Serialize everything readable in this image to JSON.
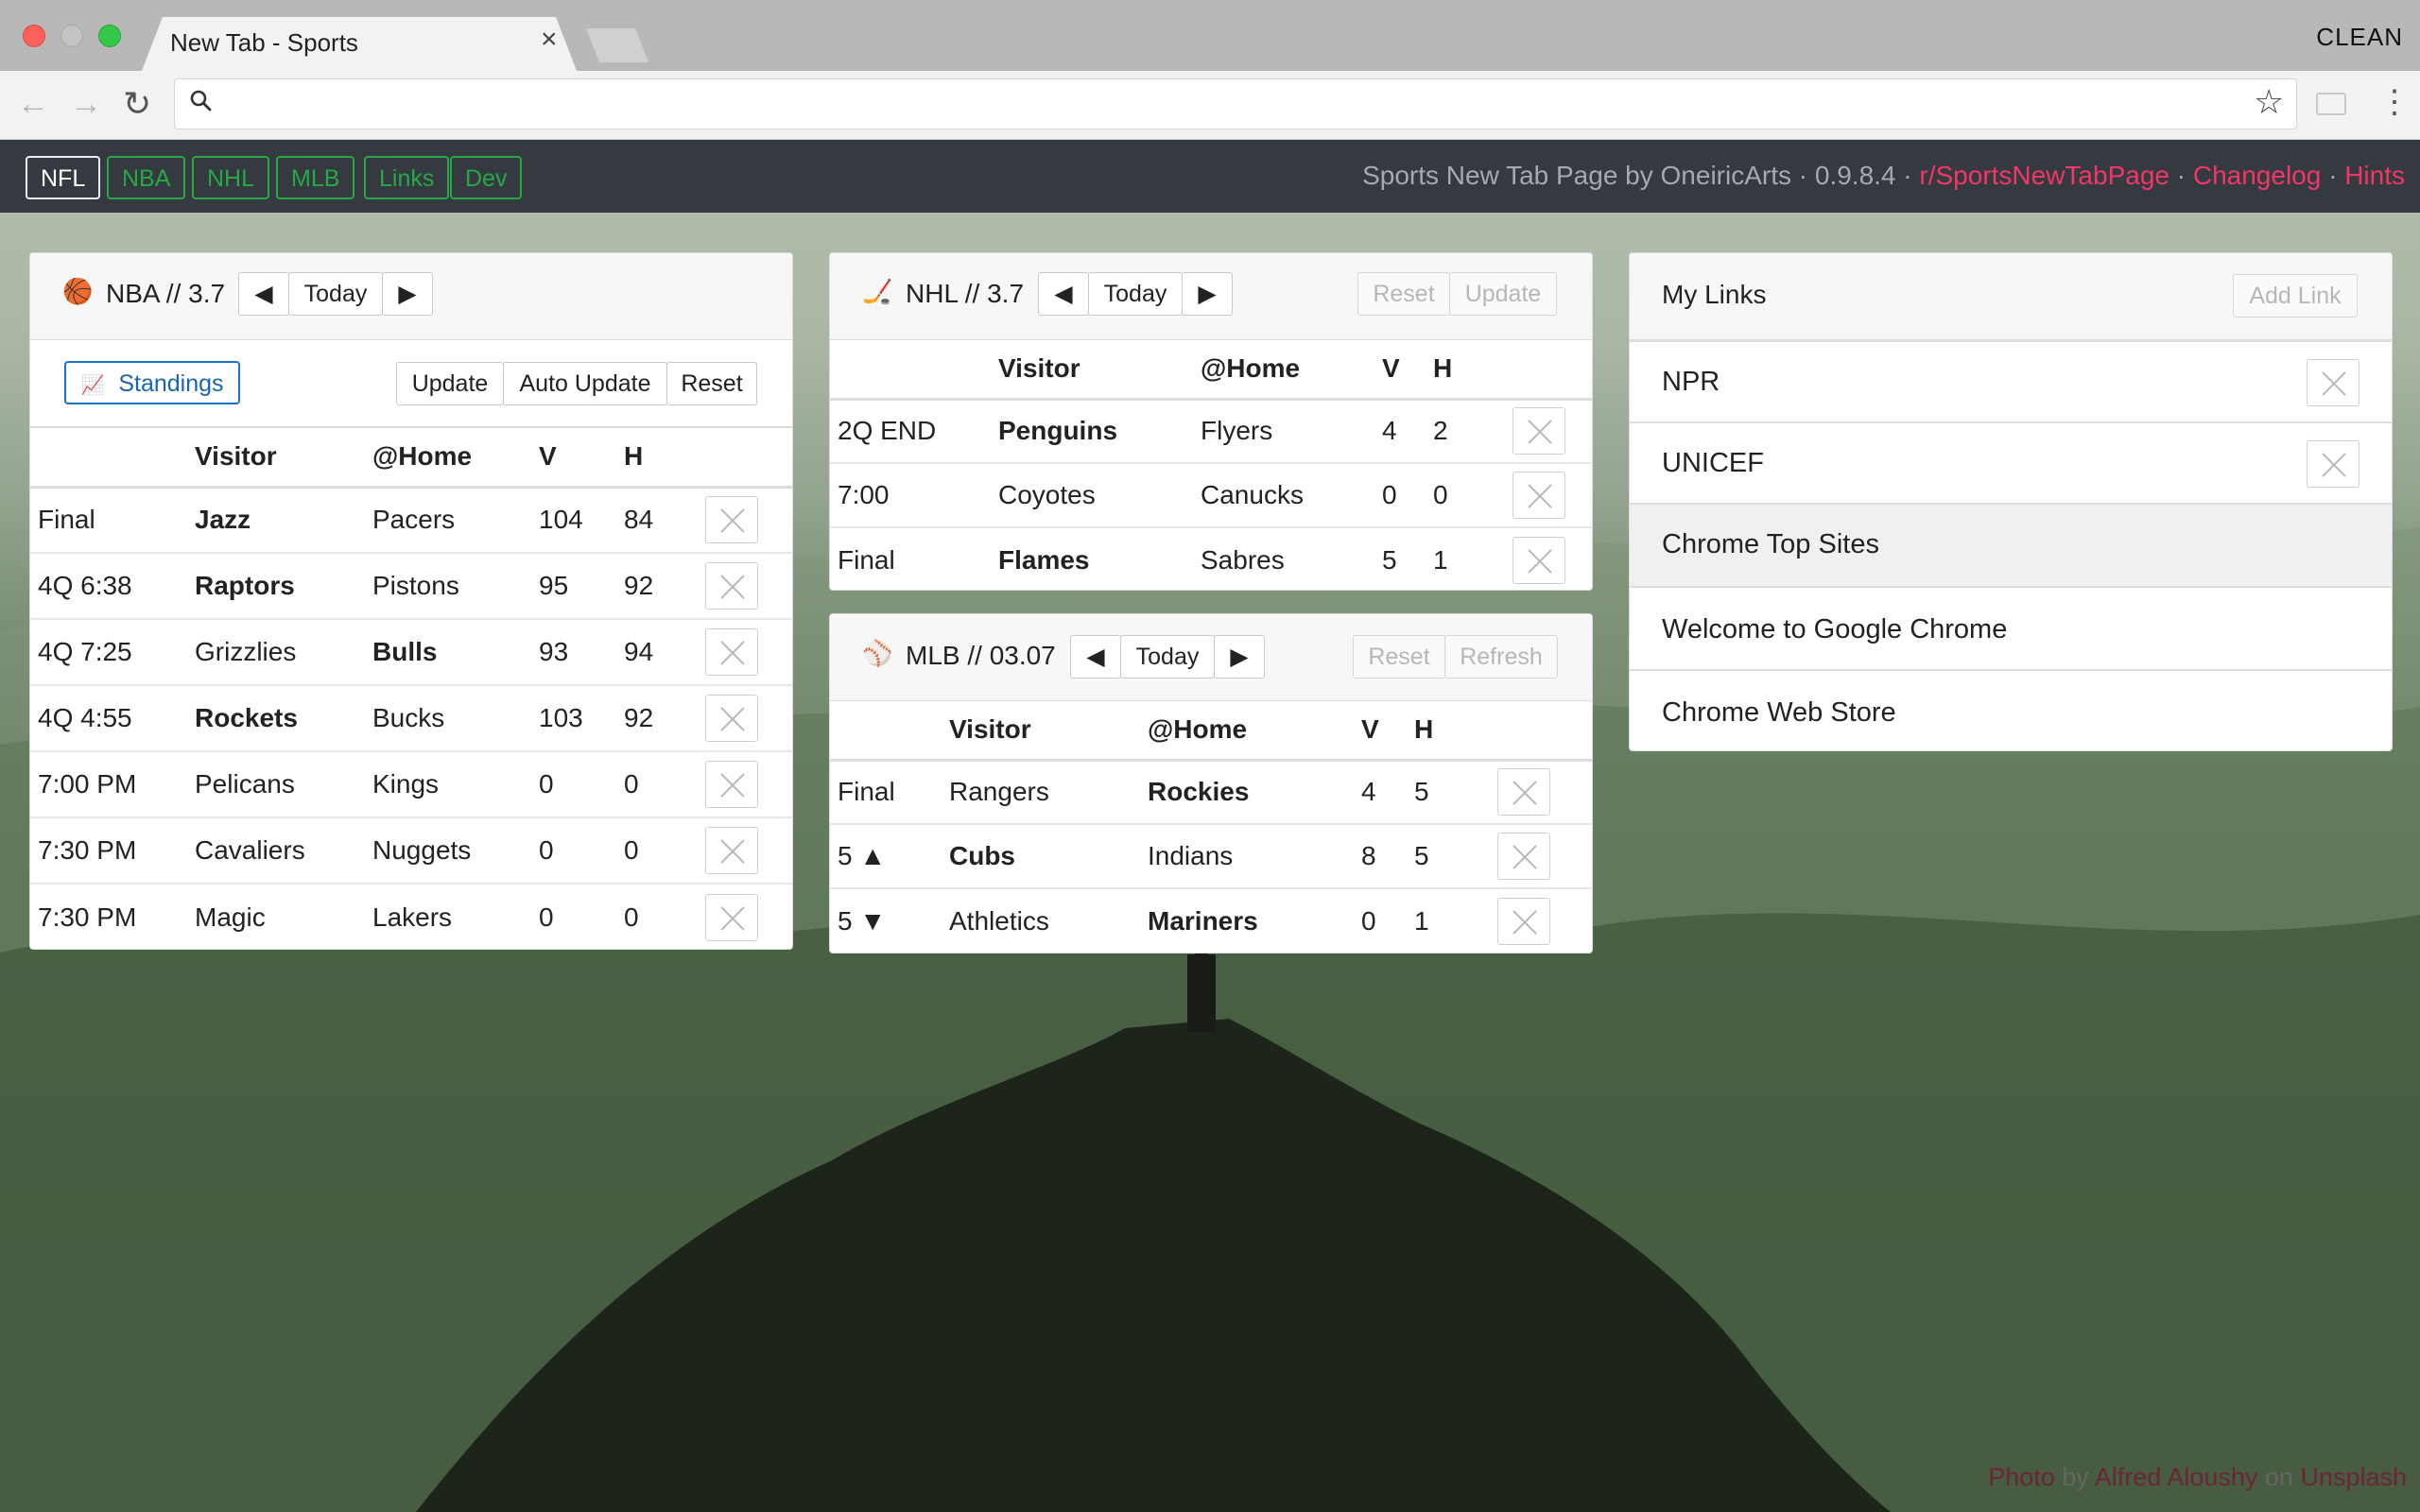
{
  "browser": {
    "tab_title": "New Tab - Sports",
    "tab_close": "×",
    "profile": "CLEAN",
    "nav": {
      "back": "←",
      "forward": "→",
      "reload": "↻",
      "star": "☆",
      "menu": "⋮"
    }
  },
  "navbar": {
    "items": [
      "NFL",
      "NBA",
      "NHL",
      "MLB",
      "Links",
      "Dev"
    ],
    "active": "NFL",
    "info": "Sports New Tab Page by OneiricArts · 0.9.8.4 · ",
    "links": {
      "subreddit": "r/SportsNewTabPage",
      "changelog": "Changelog",
      "hints": "Hints"
    },
    "sep": " · "
  },
  "nba": {
    "title": "NBA // 3.7",
    "icon": "🏀",
    "prev": "◀",
    "today": "Today",
    "next": "▶",
    "standings": "Standings",
    "standings_icon": "📈",
    "update": "Update",
    "auto_update": "Auto Update",
    "reset": "Reset",
    "headers": {
      "visitor": "Visitor",
      "home": "@Home",
      "v": "V",
      "h": "H"
    },
    "games": [
      {
        "status": "Final",
        "visitor": "Jazz",
        "home": "Pacers",
        "v": "104",
        "h": "84",
        "winner": "visitor"
      },
      {
        "status": "4Q 6:38",
        "visitor": "Raptors",
        "home": "Pistons",
        "v": "95",
        "h": "92",
        "winner": "visitor"
      },
      {
        "status": "4Q 7:25",
        "visitor": "Grizzlies",
        "home": "Bulls",
        "v": "93",
        "h": "94",
        "winner": "home"
      },
      {
        "status": "4Q 4:55",
        "visitor": "Rockets",
        "home": "Bucks",
        "v": "103",
        "h": "92",
        "winner": "visitor"
      },
      {
        "status": "7:00 PM",
        "visitor": "Pelicans",
        "home": "Kings",
        "v": "0",
        "h": "0",
        "winner": ""
      },
      {
        "status": "7:30 PM",
        "visitor": "Cavaliers",
        "home": "Nuggets",
        "v": "0",
        "h": "0",
        "winner": ""
      },
      {
        "status": "7:30 PM",
        "visitor": "Magic",
        "home": "Lakers",
        "v": "0",
        "h": "0",
        "winner": ""
      }
    ]
  },
  "nhl": {
    "title": "NHL // 3.7",
    "icon": "🏒",
    "prev": "◀",
    "today": "Today",
    "next": "▶",
    "reset": "Reset",
    "update": "Update",
    "headers": {
      "visitor": "Visitor",
      "home": "@Home",
      "v": "V",
      "h": "H"
    },
    "games": [
      {
        "status": "2Q END",
        "visitor": "Penguins",
        "home": "Flyers",
        "v": "4",
        "h": "2",
        "winner": "visitor"
      },
      {
        "status": "7:00",
        "visitor": "Coyotes",
        "home": "Canucks",
        "v": "0",
        "h": "0",
        "winner": ""
      },
      {
        "status": "Final",
        "visitor": "Flames",
        "home": "Sabres",
        "v": "5",
        "h": "1",
        "winner": "visitor"
      }
    ]
  },
  "mlb": {
    "title": "MLB // 03.07",
    "icon": "⚾",
    "prev": "◀",
    "today": "Today",
    "next": "▶",
    "reset": "Reset",
    "refresh": "Refresh",
    "headers": {
      "visitor": "Visitor",
      "home": "@Home",
      "v": "V",
      "h": "H"
    },
    "games": [
      {
        "status": "Final",
        "visitor": "Rangers",
        "home": "Rockies",
        "v": "4",
        "h": "5",
        "winner": "home"
      },
      {
        "status": "5 ▲",
        "visitor": "Cubs",
        "home": "Indians",
        "v": "8",
        "h": "5",
        "winner": "visitor"
      },
      {
        "status": "5 ▼",
        "visitor": "Athletics",
        "home": "Mariners",
        "v": "0",
        "h": "1",
        "winner": "home"
      }
    ]
  },
  "links": {
    "title": "My Links",
    "add_link": "Add Link",
    "items": [
      "NPR",
      "UNICEF"
    ],
    "top_sites_header": "Chrome Top Sites",
    "top_sites": [
      "Welcome to Google Chrome",
      "Chrome Web Store"
    ]
  },
  "credit": {
    "photo": "Photo",
    "by": " by ",
    "author": "Alfred Aloushy",
    "on": " on ",
    "site": "Unsplash"
  },
  "colors": {
    "navbar_bg": "#343a40",
    "nav_green": "#28a745",
    "accent_pink": "#f2366a",
    "standings_blue": "#1a73c8"
  }
}
